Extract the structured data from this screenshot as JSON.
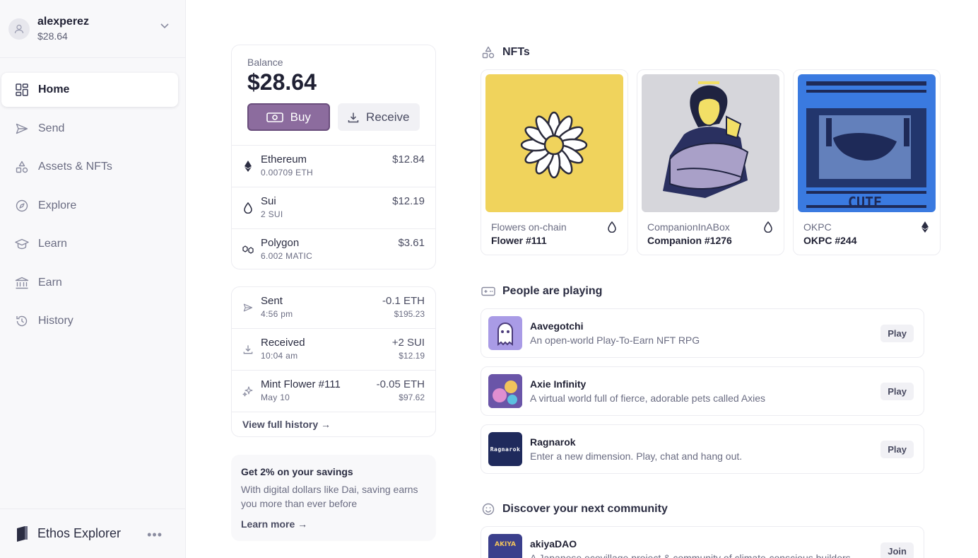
{
  "account": {
    "username": "alexperez",
    "balance": "$28.64"
  },
  "sidebar": {
    "items": [
      {
        "label": "Home",
        "icon": "home-grid-icon"
      },
      {
        "label": "Send",
        "icon": "send-icon"
      },
      {
        "label": "Assets & NFTs",
        "icon": "shapes-icon"
      },
      {
        "label": "Explore",
        "icon": "compass-icon"
      },
      {
        "label": "Learn",
        "icon": "graduation-cap-icon"
      },
      {
        "label": "Earn",
        "icon": "bank-icon"
      },
      {
        "label": "History",
        "icon": "history-icon"
      }
    ],
    "footer_label": "Ethos Explorer",
    "footer_more": "•••"
  },
  "balance_card": {
    "label": "Balance",
    "amount": "$28.64",
    "buy_label": "Buy",
    "receive_label": "Receive",
    "assets": [
      {
        "name": "Ethereum",
        "amount": "0.00709 ETH",
        "value": "$12.84",
        "icon": "ethereum-icon"
      },
      {
        "name": "Sui",
        "amount": "2 SUI",
        "value": "$12.19",
        "icon": "sui-icon"
      },
      {
        "name": "Polygon",
        "amount": "6.002 MATIC",
        "value": "$3.61",
        "icon": "polygon-icon"
      }
    ]
  },
  "activity": {
    "items": [
      {
        "title": "Sent",
        "time": "4:56 pm",
        "amount": "-0.1 ETH",
        "value": "$195.23",
        "icon": "send-icon"
      },
      {
        "title": "Received",
        "time": "10:04 am",
        "amount": "+2 SUI",
        "value": "$12.19",
        "icon": "download-icon"
      },
      {
        "title": "Mint Flower #111",
        "time": "May 10",
        "amount": "-0.05 ETH",
        "value": "$97.62",
        "icon": "sparkle-icon"
      }
    ],
    "view_all": "View full history →"
  },
  "promo": {
    "title": "Get 2% on your savings",
    "description": "With digital dollars like Dai, saving earns you more than ever before",
    "link": "Learn more →"
  },
  "nfts": {
    "title": "NFTs",
    "items": [
      {
        "collection": "Flowers on-chain",
        "name": "Flower #111",
        "chain_icon": "sui-icon"
      },
      {
        "collection": "CompanionInABox",
        "name": "Companion #1276",
        "chain_icon": "sui-icon"
      },
      {
        "collection": "OKPC",
        "name": "OKPC #244",
        "chain_icon": "ethereum-icon"
      }
    ]
  },
  "games": {
    "title": "People are playing",
    "items": [
      {
        "name": "Aavegotchi",
        "description": "An open-world Play-To-Earn NFT RPG",
        "action": "Play"
      },
      {
        "name": "Axie Infinity",
        "description": "A virtual world full of fierce, adorable pets called Axies",
        "action": "Play"
      },
      {
        "name": "Ragnarok",
        "description": "Enter a new dimension. Play, chat and hang out.",
        "action": "Play",
        "logo_text": "Ragnarok"
      }
    ]
  },
  "community": {
    "title": "Discover your next community",
    "items": [
      {
        "name": "akiyaDAO",
        "description": "A Japanese ecovillage project & community of climate-conscious builders",
        "action": "Join",
        "logo_text": "AKIYA"
      }
    ]
  },
  "okpc_art_text": "CUTE"
}
